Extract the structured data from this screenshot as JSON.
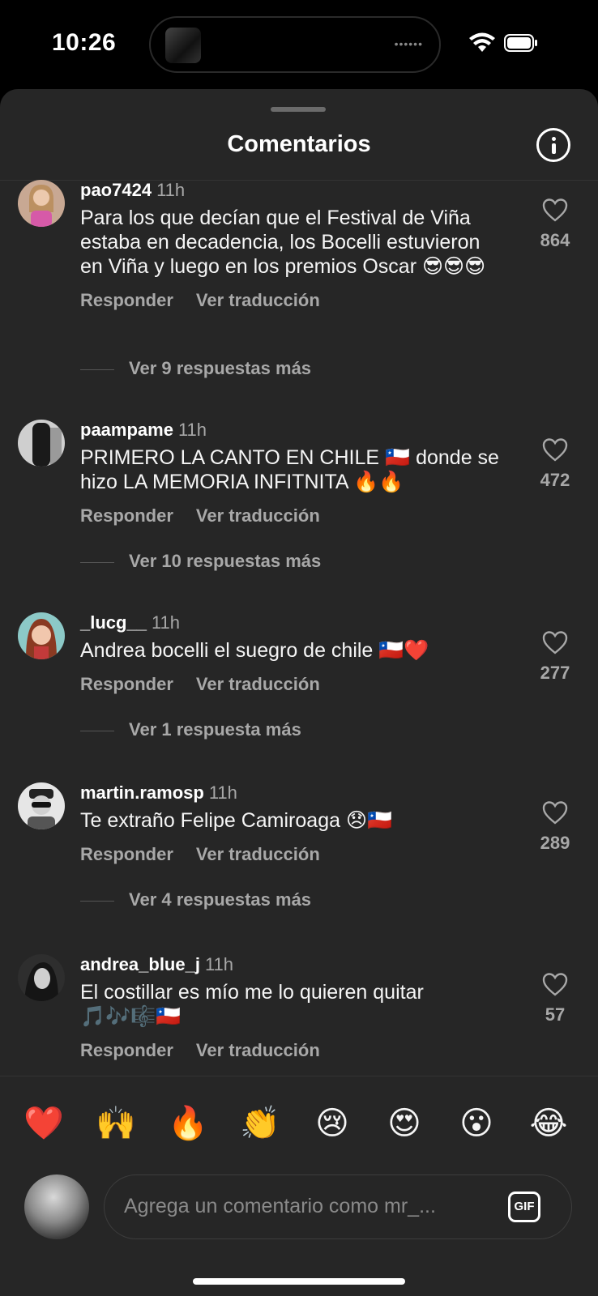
{
  "status_bar": {
    "time": "10:26"
  },
  "sheet": {
    "title": "Comentarios"
  },
  "actions": {
    "reply_label": "Responder",
    "translate_label": "Ver traducción"
  },
  "comments": [
    {
      "user": "pao7424",
      "time": "11h",
      "text": "Para los que decían que el Festival de Viña estaba en decadencia, los Bocelli estuvieron en Viña y luego en los  premios Oscar 😎😎😎",
      "likes": "864",
      "replies": "Ver 9 respuestas más",
      "avatar_color": "#c6a08a"
    },
    {
      "user": "paampame",
      "time": "11h",
      "text": "PRIMERO LA CANTO EN CHILE 🇨🇱 donde se hizo LA MEMORIA INFITNITA 🔥🔥",
      "likes": "472",
      "replies": "Ver 10 respuestas más",
      "avatar_color": "#8c8c8c"
    },
    {
      "user": "_lucg__",
      "time": "11h",
      "text": "Andrea bocelli el suegro de chile 🇨🇱❤️",
      "likes": "277",
      "replies": "Ver 1 respuesta más",
      "avatar_color": "#b07a60"
    },
    {
      "user": "martin.ramosp",
      "time": "11h",
      "text": "Te extraño Felipe Camiroaga 😞🇨🇱",
      "likes": "289",
      "replies": "Ver 4 respuestas más",
      "avatar_color": "#9e9e9e"
    },
    {
      "user": "andrea_blue_j",
      "time": "11h",
      "text": "El costillar es mío me lo quieren quitar 🎵🎶🎼🇨🇱",
      "likes": "57",
      "replies": "",
      "avatar_color": "#555555"
    }
  ],
  "reactions": [
    "❤️",
    "🙌",
    "🔥",
    "👏",
    "😢",
    "😍",
    "😮",
    "😂"
  ],
  "composer": {
    "placeholder": "Agrega un comentario como mr_...",
    "gif_label": "GIF"
  }
}
